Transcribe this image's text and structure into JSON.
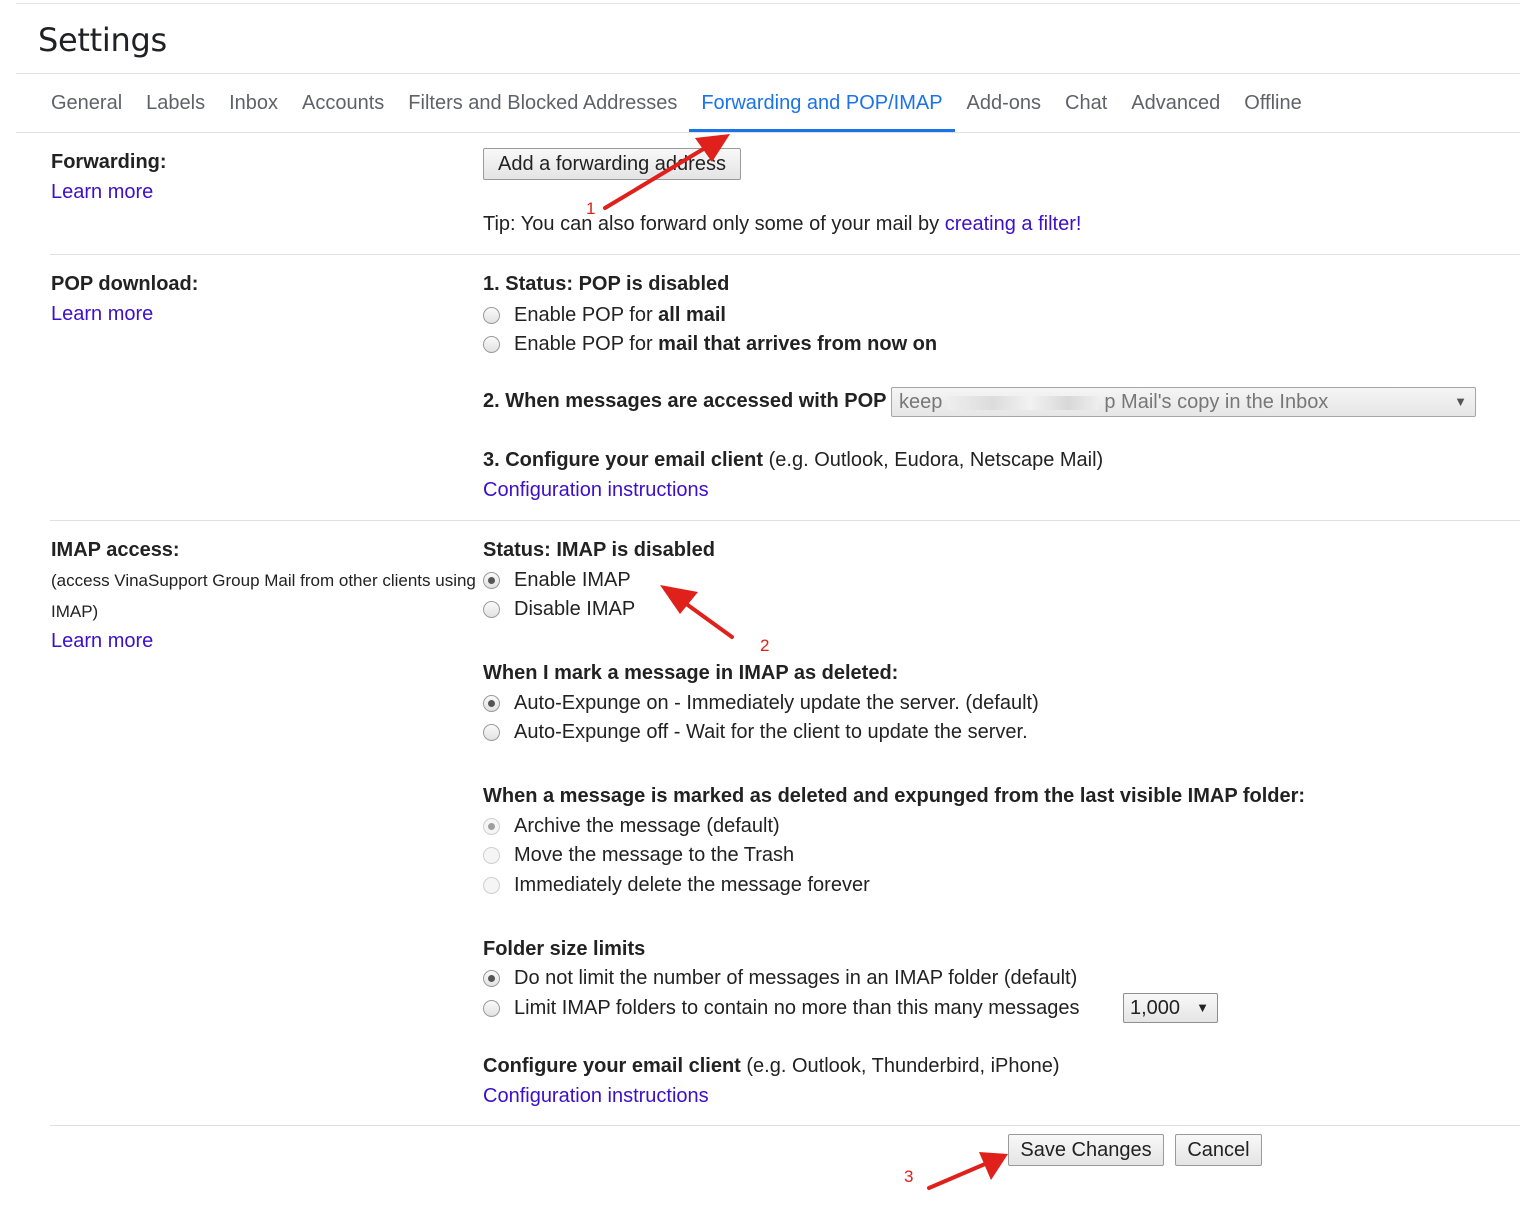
{
  "page": {
    "title": "Settings"
  },
  "tabs": [
    {
      "label": "General"
    },
    {
      "label": "Labels"
    },
    {
      "label": "Inbox"
    },
    {
      "label": "Accounts"
    },
    {
      "label": "Filters and Blocked Addresses"
    },
    {
      "label": "Forwarding and POP/IMAP",
      "active": true
    },
    {
      "label": "Add-ons"
    },
    {
      "label": "Chat"
    },
    {
      "label": "Advanced"
    },
    {
      "label": "Offline"
    }
  ],
  "forwarding": {
    "label": "Forwarding:",
    "learn_more": "Learn more",
    "add_button": "Add a forwarding address",
    "tip_prefix": "Tip: You can also forward only some of your mail by ",
    "tip_link": "creating a filter!"
  },
  "pop": {
    "label": "POP download:",
    "learn_more": "Learn more",
    "status": "1. Status: POP is disabled",
    "option_all_prefix": "Enable POP for ",
    "option_all_bold": "all mail",
    "option_now_prefix": "Enable POP for ",
    "option_now_bold": "mail that arrives from now on",
    "when_accessed_label": "2. When messages are accessed with POP",
    "when_accessed_select_start": "keep",
    "when_accessed_select_end": "p Mail's copy in the Inbox",
    "configure_bold": "3. Configure your email client",
    "configure_rest": " (e.g. Outlook, Eudora, Netscape Mail)",
    "config_link": "Configuration instructions"
  },
  "imap": {
    "label": "IMAP access:",
    "sublabel": "(access VinaSupport Group Mail from other clients using IMAP)",
    "learn_more": "Learn more",
    "status": "Status: IMAP is disabled",
    "enable": "Enable IMAP",
    "disable": "Disable IMAP",
    "deleted_heading": "When I mark a message in IMAP as deleted:",
    "expunge_on": "Auto-Expunge on - Immediately update the server. (default)",
    "expunge_off": "Auto-Expunge off - Wait for the client to update the server.",
    "expunged_heading": "When a message is marked as deleted and expunged from the last visible IMAP folder:",
    "archive": "Archive the message (default)",
    "trash": "Move the message to the Trash",
    "delete_forever": "Immediately delete the message forever",
    "folder_heading": "Folder size limits",
    "no_limit": "Do not limit the number of messages in an IMAP folder (default)",
    "limit": "Limit IMAP folders to contain no more than this many messages",
    "limit_value": "1,000",
    "configure_bold": "Configure your email client",
    "configure_rest": " (e.g. Outlook, Thunderbird, iPhone)",
    "config_link": "Configuration instructions"
  },
  "footer": {
    "save": "Save Changes",
    "cancel": "Cancel"
  },
  "annotations": {
    "step1": "1",
    "step2": "2",
    "step3": "3",
    "arrow_color": "#e0201b"
  },
  "icons": {
    "dropdown_arrow": "▼"
  },
  "colors": {
    "link": "#3c10c9",
    "active_tab": "#1a73e8"
  }
}
